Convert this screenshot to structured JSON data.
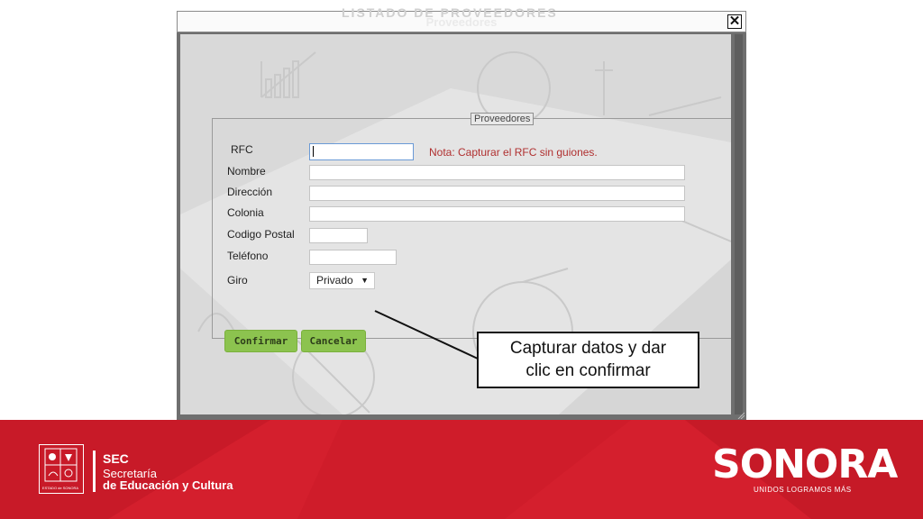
{
  "dialog": {
    "title": "Proveedores",
    "background_title": "LISTADO DE PROVEEDORES",
    "close_symbol": "✕"
  },
  "form": {
    "legend": "Proveedores",
    "fields": [
      {
        "label": "RFC",
        "value": ""
      },
      {
        "label": "Nombre",
        "value": ""
      },
      {
        "label": "Dirección",
        "value": ""
      },
      {
        "label": "Colonia",
        "value": ""
      },
      {
        "label": "Codigo Postal",
        "value": ""
      },
      {
        "label": "Teléfono",
        "value": ""
      }
    ],
    "rfc_note": "Nota: Capturar el RFC sin guiones.",
    "giro": {
      "label": "Giro",
      "selected": "Privado",
      "arrow": "▼"
    },
    "buttons": {
      "confirm": "Confirmar",
      "cancel": "Cancelar"
    }
  },
  "callout": {
    "line1": "Capturar datos y dar",
    "line2": "clic en confirmar"
  },
  "footer": {
    "sec": "SEC",
    "line1": "Secretaría",
    "line2": "de Educación y Cultura",
    "brand": "SONORA",
    "slogan": "UNIDOS LOGRAMOS MÁS",
    "crest_caption": "ESTADO de SONORA"
  },
  "colors": {
    "footer_red": "#d41f2d",
    "button_green": "#8cc34f",
    "note_red": "#b03030"
  }
}
